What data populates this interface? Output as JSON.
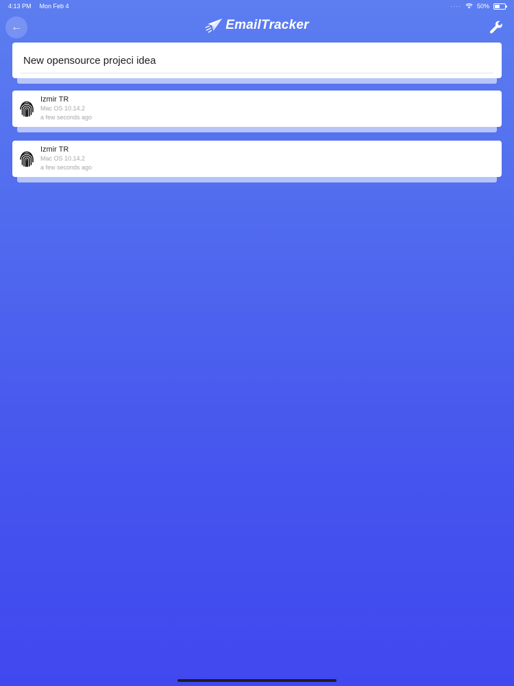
{
  "status_bar": {
    "time": "4:13 PM",
    "date": "Mon Feb 4",
    "battery": "50%",
    "battery_level": 0.5,
    "signal_icon": "dots-icon",
    "wifi_icon": "wifi-icon"
  },
  "nav": {
    "back_icon": "arrow-left-icon",
    "back_glyph": "←",
    "logo_icon": "paper-plane-icon",
    "logo_text": "EmailTracker",
    "settings_icon": "wrench-icon"
  },
  "email": {
    "title": "New opensource projeci idea"
  },
  "opens": [
    {
      "location": "Izmir TR",
      "os": "Mac OS 10.14.2",
      "time": "a few seconds ago",
      "icon": "fingerprint-icon"
    },
    {
      "location": "Izmir TR",
      "os": "Mac OS 10.14.2",
      "time": "a few seconds ago",
      "icon": "fingerprint-icon"
    }
  ],
  "colors": {
    "gradient_top": "#5c7ef0",
    "gradient_bottom": "#4148ef",
    "card": "#ffffff",
    "muted_text": "#a7a7a7"
  }
}
